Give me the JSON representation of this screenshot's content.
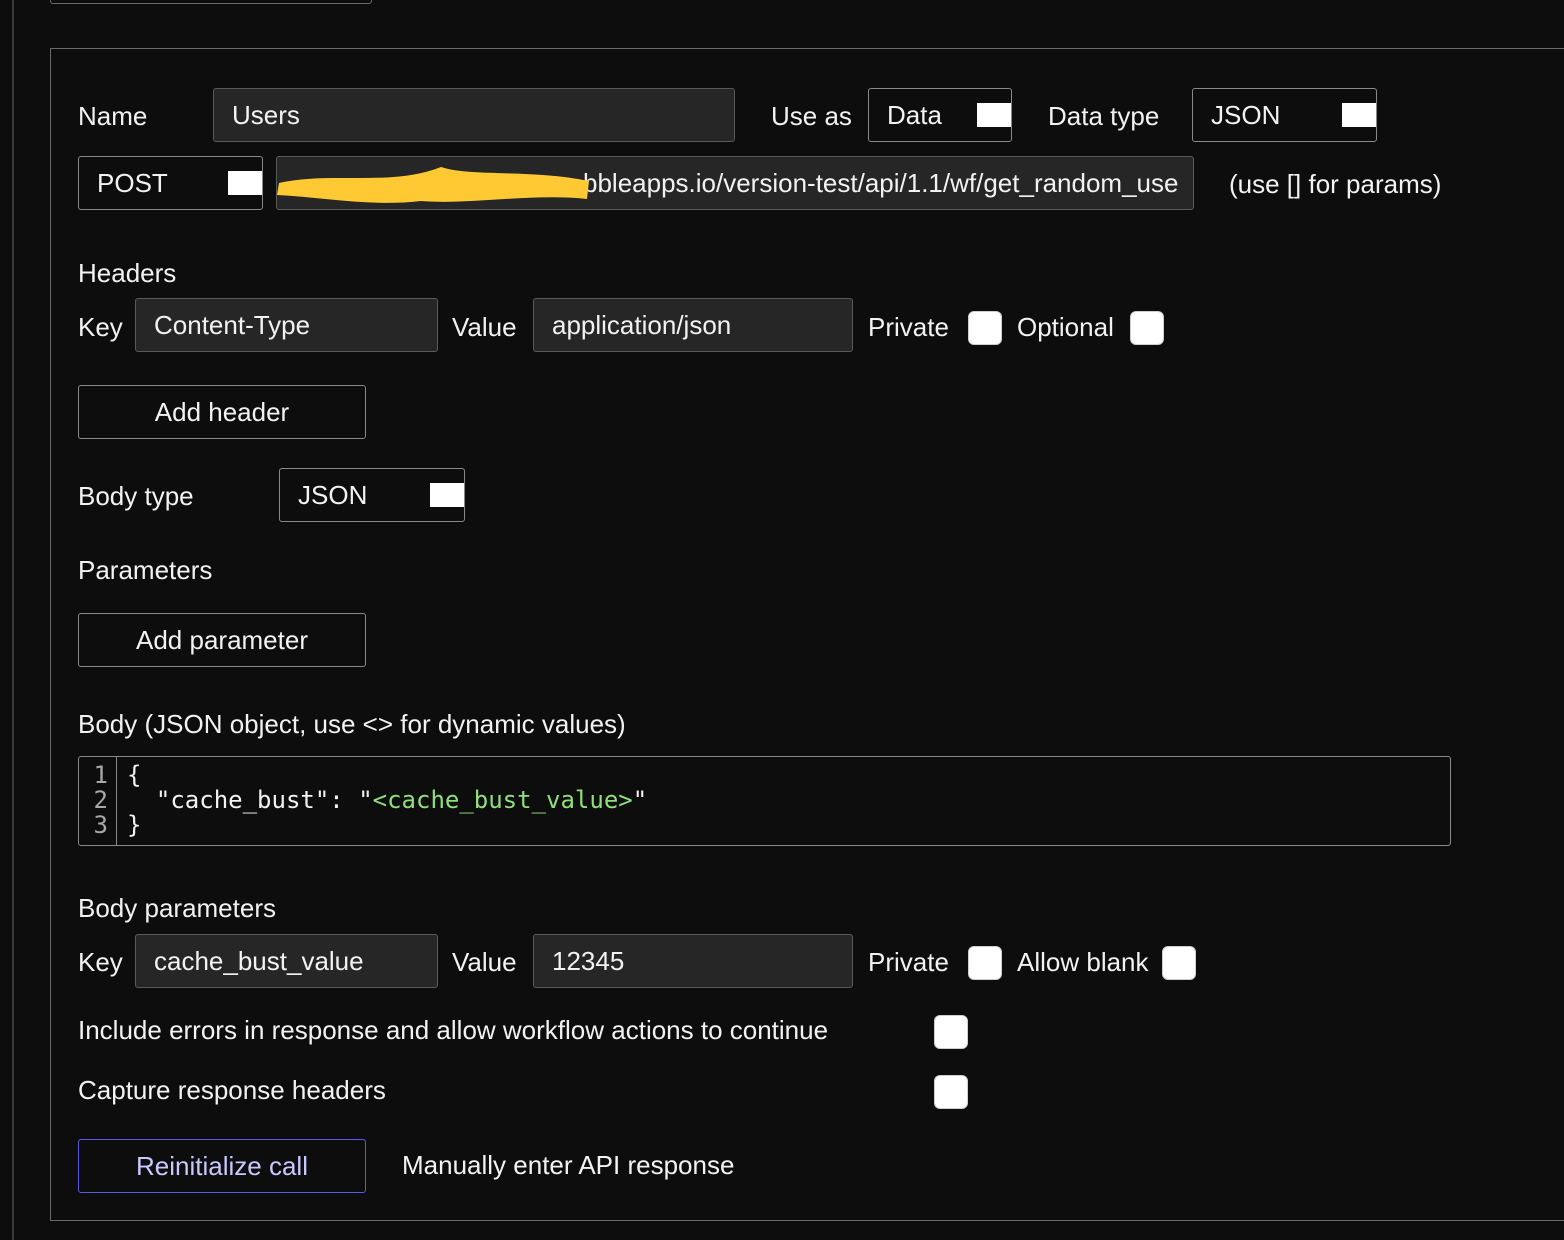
{
  "call": {
    "name_label": "Name",
    "name_value": "Users",
    "use_as_label": "Use as",
    "use_as_value": "Data",
    "data_type_label": "Data type",
    "data_type_value": "JSON",
    "method_value": "POST",
    "url_visible": "bbleapps.io/version-test/api/1.1/wf/get_random_use",
    "url_hint": "(use [] for params)"
  },
  "headers": {
    "title": "Headers",
    "key_label": "Key",
    "key_value": "Content-Type",
    "value_label": "Value",
    "value_value": "application/json",
    "private_label": "Private",
    "optional_label": "Optional",
    "add_button": "Add header"
  },
  "body_type": {
    "label": "Body type",
    "value": "JSON"
  },
  "parameters": {
    "title": "Parameters",
    "add_button": "Add parameter"
  },
  "body": {
    "title": "Body (JSON object, use <> for dynamic values)",
    "line_numbers": [
      "1",
      "2",
      "3"
    ],
    "line1": "{",
    "line2_key": "  \"cache_bust\": \"",
    "line2_dynamic": "<cache_bust_value>",
    "line2_end": "\"",
    "line3": "}"
  },
  "body_parameters": {
    "title": "Body parameters",
    "key_label": "Key",
    "key_value": "cache_bust_value",
    "value_label": "Value",
    "value_value": "12345",
    "private_label": "Private",
    "allow_blank_label": "Allow blank"
  },
  "options": {
    "include_errors_label": "Include errors in response and allow workflow actions to continue",
    "capture_headers_label": "Capture response headers"
  },
  "actions": {
    "reinitialize_button": "Reinitialize call",
    "manual_link": "Manually enter API response"
  },
  "colors": {
    "background": "#0d0d0d",
    "field_bg": "#262626",
    "redaction": "#ffc933",
    "dynamic_value": "#8fe07a",
    "reinitialize_border": "#5a5ae0",
    "reinitialize_text": "#c8c8ff"
  }
}
